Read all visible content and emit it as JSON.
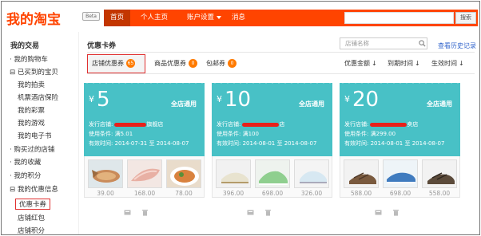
{
  "header": {
    "logo": "我的淘宝",
    "beta": "Beta",
    "nav": [
      "首页",
      "个人主页",
      "账户设置",
      "消息"
    ],
    "search_button": "搜索"
  },
  "sidebar": {
    "title": "我的交易",
    "items": [
      "· 我的购物车",
      "⊟ 已买到的宝贝",
      "我的拍卖",
      "机票酒店保险",
      "我的彩票",
      "我的游戏",
      "我的电子书",
      "· 购买过的店铺",
      "· 我的收藏",
      "· 我的积分",
      "⊟ 我的优惠信息",
      "优惠卡券",
      "店铺红包",
      "店铺积分"
    ]
  },
  "main": {
    "title": "优惠卡券",
    "search_placeholder": "店铺名称",
    "history_link": "查看历史记录",
    "tabs": [
      {
        "label": "店铺优惠券",
        "count": "65"
      },
      {
        "label": "商品优惠券",
        "count": "0"
      },
      {
        "label": "包邮券",
        "count": "0"
      }
    ],
    "sort": [
      "优惠金额",
      "到期时间",
      "生效时间"
    ],
    "sort_arrow": "↓"
  },
  "coupons": [
    {
      "yen": "¥",
      "amount": "5",
      "scope": "全店通用",
      "shop_label": "发行店铺:",
      "shop_suffix": "旗舰店",
      "condition": "使用条件: 满5.01",
      "validity": "有效时间: 2014-07-31 至 2014-08-07",
      "prices": [
        "39.00",
        "168.00",
        "78.00"
      ]
    },
    {
      "yen": "¥",
      "amount": "10",
      "scope": "全店通用",
      "shop_label": "发行店铺:",
      "shop_suffix": "店",
      "condition": "使用条件: 满100",
      "validity": "有效时间: 2014-08-01 至 2014-08-07",
      "prices": [
        "396.00",
        "698.00",
        "326.00"
      ]
    },
    {
      "yen": "¥",
      "amount": "20",
      "scope": "全店通用",
      "shop_label": "发行店铺:",
      "shop_suffix": "卖店",
      "condition": "使用条件: 满299.00",
      "validity": "有效时间: 2014-08-01 至 2014-08-07",
      "prices": [
        "588.00",
        "698.00",
        "558.00"
      ]
    }
  ],
  "colors": {
    "brand": "#ff4400",
    "coupon": "#48c1c6",
    "badge": "#ff7a00",
    "highlight_border": "#e03030",
    "link": "#3366cc"
  }
}
